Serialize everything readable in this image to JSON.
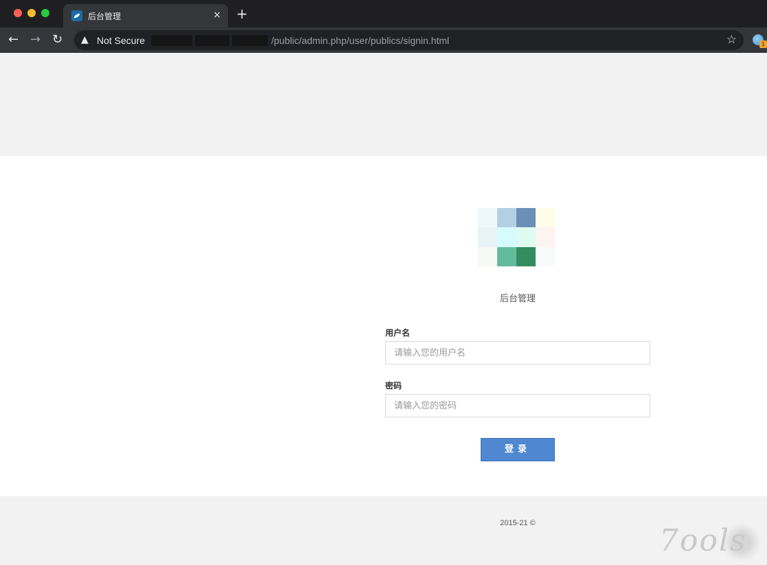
{
  "browser": {
    "tab_title": "后台管理",
    "tab_close": "×",
    "new_tab": "+",
    "security_label": "Not Secure",
    "url_visible": "/public/admin.php/user/publics/signin.html",
    "ext_badge": "1"
  },
  "page": {
    "site_name": "后台管理",
    "logo_colors": [
      [
        "#eef7fb",
        "#b2d0e2",
        "#6b90b8",
        "#fdfde8"
      ],
      [
        "#e8f3f6",
        "#d6fbfd",
        "#dffbef",
        "#fdf5f1"
      ],
      [
        "#f7f9f4",
        "#64bb9c",
        "#338c5e",
        "#f9fafa"
      ]
    ],
    "form": {
      "username_label": "用户名",
      "username_placeholder": "请输入您的用户名",
      "password_label": "密码",
      "password_placeholder": "请输入您的密码",
      "login_button": "登录"
    },
    "footer": "2015-21 ©",
    "watermark": "7ools"
  },
  "colors": {
    "accent": "#4f88d0",
    "page_bg": "#f2f2f2",
    "panel_bg": "#ffffff"
  }
}
